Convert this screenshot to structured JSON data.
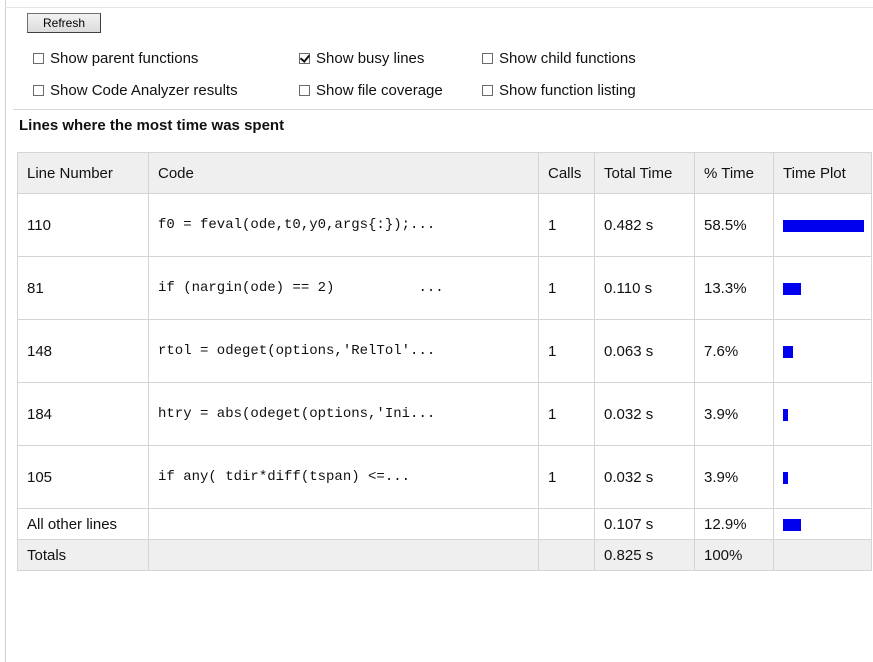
{
  "toolbar": {
    "refresh_label": "Refresh"
  },
  "options": {
    "show_parent_functions": {
      "label": "Show parent functions",
      "checked": false
    },
    "show_busy_lines": {
      "label": "Show busy lines",
      "checked": true
    },
    "show_child_functions": {
      "label": "Show child functions",
      "checked": false
    },
    "show_code_analyzer": {
      "label": "Show Code Analyzer results",
      "checked": false
    },
    "show_file_coverage": {
      "label": "Show file coverage",
      "checked": false
    },
    "show_function_listing": {
      "label": "Show function listing",
      "checked": false
    }
  },
  "section": {
    "title": "Lines where the most time was spent"
  },
  "table": {
    "headers": {
      "line_number": "Line Number",
      "code": "Code",
      "calls": "Calls",
      "total_time": "Total Time",
      "percent_time": "% Time",
      "time_plot": "Time Plot"
    },
    "rows": [
      {
        "line": "110",
        "code": "f0 = feval(ode,t0,y0,args{:});...",
        "calls": "1",
        "total_time": "0.482 s",
        "percent": "58.5%",
        "fraction": 0.585
      },
      {
        "line": "81",
        "code": "if (nargin(ode) == 2)          ...",
        "calls": "1",
        "total_time": "0.110 s",
        "percent": "13.3%",
        "fraction": 0.133
      },
      {
        "line": "148",
        "code": "rtol = odeget(options,'RelTol'...",
        "calls": "1",
        "total_time": "0.063 s",
        "percent": "7.6%",
        "fraction": 0.076
      },
      {
        "line": "184",
        "code": "htry = abs(odeget(options,'Ini...",
        "calls": "1",
        "total_time": "0.032 s",
        "percent": "3.9%",
        "fraction": 0.039
      },
      {
        "line": "105",
        "code": "if any( tdir*diff(tspan) <=...",
        "calls": "1",
        "total_time": "0.032 s",
        "percent": "3.9%",
        "fraction": 0.039
      }
    ],
    "other": {
      "label": "All other lines",
      "total_time": "0.107 s",
      "percent": "12.9%",
      "fraction": 0.129
    },
    "totals": {
      "label": "Totals",
      "total_time": "0.825 s",
      "percent": "100%"
    }
  },
  "colors": {
    "bar": "#0000ee"
  }
}
